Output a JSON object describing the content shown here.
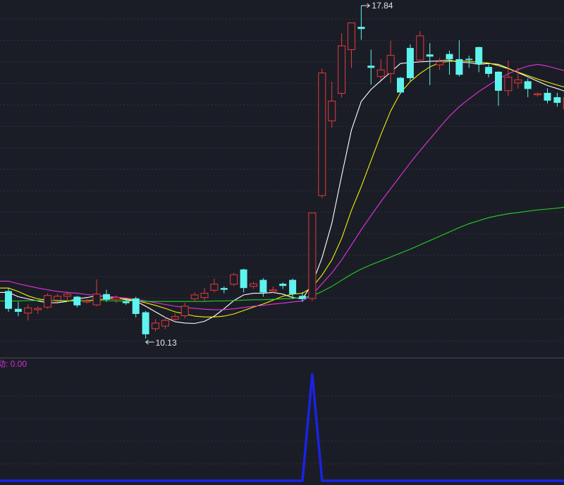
{
  "colors": {
    "background": "#1b1d26",
    "grid": "#2c3040",
    "divider": "#474b5a",
    "up": "#e4393c",
    "down": "#5ef3ef",
    "ma5": "#ffffff",
    "ma10": "#f2f200",
    "ma20": "#e333e3",
    "ma60": "#23d123",
    "indicator": "#1b22e6",
    "label_text": "#e6e6e6",
    "indicator_label": "#d42ad4"
  },
  "annotations": {
    "high_label": "17.84",
    "low_label": "10.13"
  },
  "indicator_panel": {
    "label": "动: 0.00"
  },
  "chart_data": [
    {
      "type": "candlestick",
      "title": "",
      "price_range": [
        9.6,
        17.9
      ],
      "grid": true,
      "candles": [
        [
          11.23,
          10.82,
          11.3,
          10.75
        ],
        [
          10.82,
          10.75,
          10.98,
          10.65
        ],
        [
          10.72,
          10.84,
          10.92,
          10.55
        ],
        [
          10.8,
          10.83,
          10.88,
          10.7
        ],
        [
          10.86,
          11.13,
          11.18,
          10.82
        ],
        [
          11.02,
          11.11,
          11.16,
          10.97
        ],
        [
          11.11,
          11.16,
          11.2,
          10.98
        ],
        [
          11.1,
          10.9,
          11.12,
          10.85
        ],
        [
          10.99,
          11.0,
          11.05,
          10.95
        ],
        [
          10.91,
          11.16,
          11.5,
          10.88
        ],
        [
          11.16,
          11.03,
          11.26,
          10.98
        ],
        [
          11.04,
          11.08,
          11.13,
          10.95
        ],
        [
          10.99,
          10.95,
          11.02,
          10.91
        ],
        [
          11.06,
          10.7,
          11.1,
          10.62
        ],
        [
          10.74,
          10.23,
          10.77,
          10.13
        ],
        [
          10.36,
          10.49,
          10.58,
          10.3
        ],
        [
          10.42,
          10.55,
          10.63,
          10.35
        ],
        [
          10.58,
          10.64,
          10.71,
          10.52
        ],
        [
          10.66,
          10.88,
          10.96,
          10.6
        ],
        [
          11.05,
          11.14,
          11.2,
          10.98
        ],
        [
          11.08,
          11.18,
          11.3,
          11.0
        ],
        [
          11.25,
          11.39,
          11.52,
          11.2
        ],
        [
          11.3,
          11.26,
          11.34,
          11.18
        ],
        [
          11.39,
          11.61,
          11.65,
          11.34
        ],
        [
          11.73,
          11.3,
          11.75,
          11.2
        ],
        [
          11.34,
          11.4,
          11.44,
          11.28
        ],
        [
          11.49,
          11.2,
          11.53,
          11.1
        ],
        [
          11.23,
          11.26,
          11.34,
          11.19
        ],
        [
          11.4,
          11.35,
          11.43,
          11.28
        ],
        [
          11.49,
          11.16,
          11.52,
          11.05
        ],
        [
          11.12,
          11.05,
          11.21,
          10.98
        ],
        [
          11.06,
          13.04,
          13.05,
          11.0
        ],
        [
          13.44,
          16.28,
          16.38,
          13.38
        ],
        [
          15.17,
          15.63,
          16.08,
          15.01
        ],
        [
          15.81,
          16.91,
          17.2,
          15.71
        ],
        [
          16.82,
          17.44,
          17.44,
          16.4
        ],
        [
          17.35,
          17.3,
          17.84,
          17.05
        ],
        [
          16.45,
          16.4,
          16.82,
          16.01
        ],
        [
          16.2,
          16.35,
          16.6,
          16.12
        ],
        [
          16.27,
          16.69,
          17.03,
          16.05
        ],
        [
          16.17,
          15.83,
          16.19,
          15.79
        ],
        [
          16.86,
          16.16,
          16.94,
          16.08
        ],
        [
          16.58,
          17.14,
          17.25,
          16.52
        ],
        [
          16.71,
          16.66,
          16.97,
          16.0
        ],
        [
          16.47,
          16.54,
          16.63,
          16.35
        ],
        [
          16.72,
          16.6,
          16.8,
          16.24
        ],
        [
          16.6,
          16.24,
          17.04,
          16.2
        ],
        [
          16.61,
          16.58,
          16.68,
          16.4
        ],
        [
          16.88,
          16.48,
          16.89,
          16.3
        ],
        [
          16.42,
          16.26,
          16.48,
          16.18
        ],
        [
          16.31,
          15.87,
          16.32,
          15.52
        ],
        [
          15.87,
          16.18,
          16.57,
          15.75
        ],
        [
          16.05,
          16.12,
          16.4,
          15.92
        ],
        [
          16.09,
          15.91,
          16.15,
          15.72
        ],
        [
          15.79,
          15.8,
          15.83,
          15.73
        ],
        [
          15.82,
          15.64,
          15.93,
          15.58
        ],
        [
          15.72,
          15.59,
          15.82,
          15.5
        ],
        [
          15.45,
          15.71,
          15.8,
          15.42
        ],
        [
          15.72,
          15.72,
          15.8,
          15.58
        ]
      ],
      "ma_lines": [
        {
          "name": "MA5",
          "values": [
            11.2,
            11.1,
            11.05,
            11.0,
            10.96,
            10.96,
            10.99,
            11.05,
            11.08,
            11.12,
            11.11,
            11.07,
            11.03,
            11.0,
            10.88,
            10.75,
            10.62,
            10.52,
            10.49,
            10.48,
            10.53,
            10.65,
            10.82,
            11.01,
            11.14,
            11.18,
            11.18,
            11.2,
            11.16,
            11.08,
            11.05,
            11.4,
            12.0,
            12.8,
            13.9,
            14.96,
            15.62,
            15.9,
            16.1,
            16.3,
            16.5,
            16.52,
            16.54,
            16.55,
            16.56,
            16.58,
            16.53,
            16.52,
            16.48,
            16.5,
            16.48,
            16.39,
            16.29,
            16.19,
            16.09,
            15.99,
            15.92,
            15.84,
            15.79
          ]
        },
        {
          "name": "MA10",
          "values": [
            11.3,
            11.22,
            11.12,
            11.05,
            11.02,
            11.0,
            11.0,
            11.0,
            11.01,
            11.03,
            11.05,
            11.06,
            11.05,
            11.01,
            10.96,
            10.9,
            10.83,
            10.75,
            10.7,
            10.65,
            10.63,
            10.63,
            10.65,
            10.7,
            10.78,
            10.86,
            10.93,
            11.02,
            11.11,
            11.16,
            11.18,
            11.32,
            11.6,
            11.95,
            12.45,
            13.1,
            13.65,
            14.25,
            14.85,
            15.4,
            15.82,
            16.08,
            16.27,
            16.42,
            16.52,
            16.55,
            16.56,
            16.55,
            16.53,
            16.51,
            16.45,
            16.38,
            16.3,
            16.22,
            16.14,
            16.07,
            16.0,
            15.94,
            15.89
          ]
        },
        {
          "name": "MA20",
          "values": [
            11.46,
            11.4,
            11.35,
            11.3,
            11.26,
            11.22,
            11.2,
            11.18,
            11.15,
            11.13,
            11.11,
            11.09,
            11.07,
            11.04,
            11.0,
            10.96,
            10.92,
            10.88,
            10.85,
            10.83,
            10.81,
            10.8,
            10.8,
            10.82,
            10.85,
            10.88,
            10.9,
            10.93,
            10.95,
            10.98,
            11.0,
            11.15,
            11.4,
            11.65,
            11.95,
            12.3,
            12.65,
            12.98,
            13.3,
            13.6,
            13.9,
            14.2,
            14.48,
            14.75,
            15.02,
            15.28,
            15.5,
            15.68,
            15.85,
            16.0,
            16.14,
            16.26,
            16.36,
            16.44,
            16.48,
            16.44,
            16.38,
            16.32,
            16.26
          ]
        },
        {
          "name": "MA60",
          "values": [
            11.0,
            11.0,
            11.01,
            11.01,
            11.01,
            11.01,
            11.01,
            11.01,
            11.01,
            11.01,
            11.01,
            11.0,
            11.0,
            11.0,
            10.99,
            10.99,
            10.99,
            10.99,
            10.99,
            10.99,
            10.99,
            11.0,
            11.0,
            11.01,
            11.02,
            11.03,
            11.03,
            11.04,
            11.05,
            11.06,
            11.08,
            11.12,
            11.22,
            11.34,
            11.48,
            11.62,
            11.74,
            11.84,
            11.93,
            12.02,
            12.11,
            12.2,
            12.3,
            12.4,
            12.5,
            12.6,
            12.7,
            12.79,
            12.86,
            12.93,
            12.98,
            13.02,
            13.05,
            13.08,
            13.11,
            13.13,
            13.15,
            13.18,
            13.22
          ]
        }
      ]
    },
    {
      "type": "line",
      "title": "",
      "ylim": [
        0,
        1
      ],
      "series": [
        {
          "values": [
            0,
            0,
            0,
            0,
            0,
            0,
            0,
            0,
            0,
            0,
            0,
            0,
            0,
            0,
            0,
            0,
            0,
            0,
            0,
            0,
            0,
            0,
            0,
            0,
            0,
            0,
            0,
            0,
            0,
            0,
            0,
            1,
            0,
            0,
            0,
            0,
            0,
            0,
            0,
            0,
            0,
            0,
            0,
            0,
            0,
            0,
            0,
            0,
            0,
            0,
            0,
            0,
            0,
            0,
            0,
            0,
            0,
            0,
            0
          ]
        }
      ]
    }
  ]
}
